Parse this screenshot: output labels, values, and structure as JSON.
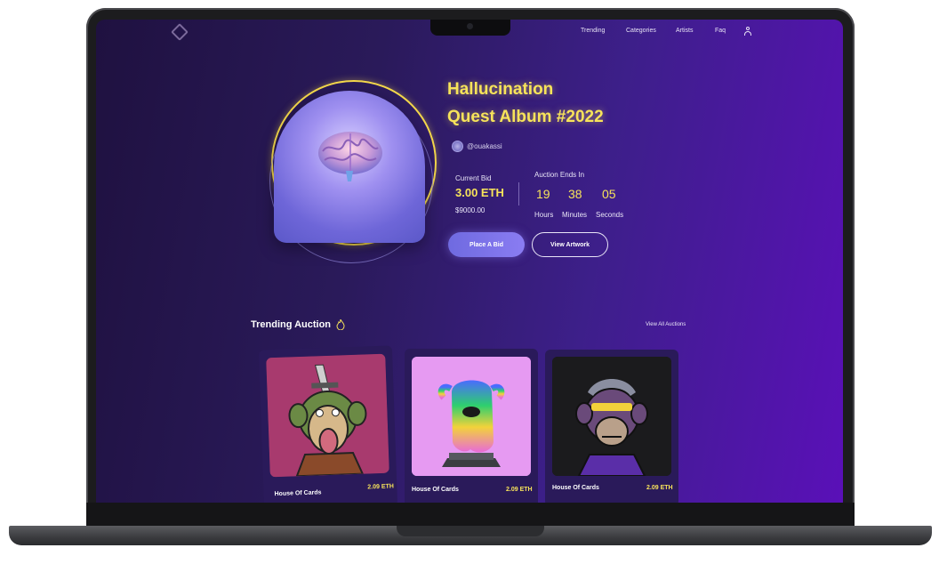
{
  "nav": {
    "items": [
      "Trending",
      "Categories",
      "Artists",
      "Faq"
    ]
  },
  "hero": {
    "title_line1": "Hallucination",
    "title_line2": "Quest Album #2022",
    "handle": "@ouakassi",
    "current_bid_label": "Current Bid",
    "current_bid_value": "3.00 ETH",
    "current_bid_usd": "$9000.00",
    "auction_label": "Auction Ends In",
    "hours": "19",
    "minutes": "38",
    "seconds": "05",
    "hours_label": "Hours",
    "minutes_label": "Minutes",
    "seconds_label": "Seconds",
    "place_bid": "Place A Bid",
    "view_artwork": "View Artwork"
  },
  "trending": {
    "title": "Trending Auction",
    "view_all": "View All Auctions",
    "cards": [
      {
        "name": "House Of Cards",
        "price": "2.09 ETH"
      },
      {
        "name": "House Of Cards",
        "price": "2.09 ETH"
      },
      {
        "name": "House Of Cards",
        "price": "2.09 ETH"
      }
    ]
  },
  "colors": {
    "accent_yellow": "#f7e35a",
    "bg_left": "#1f1140",
    "bg_right": "#5a10b8",
    "button_purple": "#7c72e8"
  }
}
